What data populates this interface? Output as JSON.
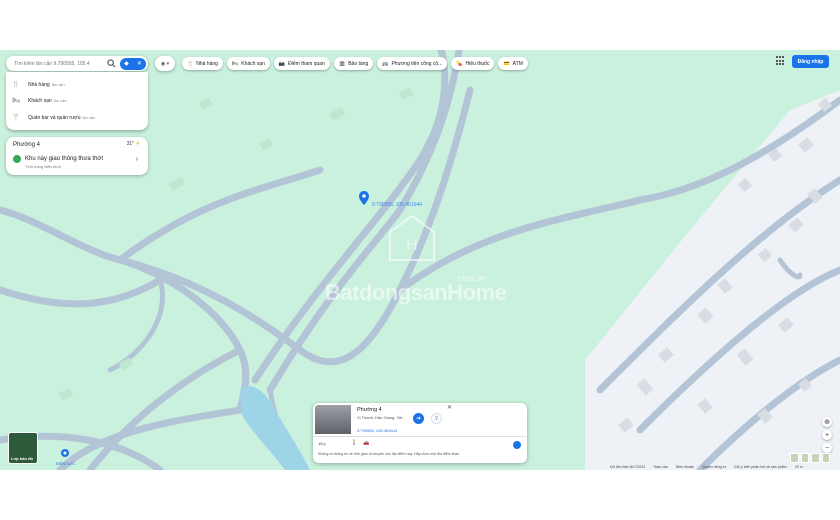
{
  "search": {
    "placeholder": "Tìm kiếm lân cận 9.790555, 105.4",
    "value": ""
  },
  "dropdown": [
    {
      "icon": "fork-knife-icon",
      "glyph": "🍴",
      "label": "Nhà hàng",
      "hint": "lân cận"
    },
    {
      "icon": "bed-icon",
      "glyph": "🛏",
      "label": "Khách sạn",
      "hint": "lân cận"
    },
    {
      "icon": "glass-icon",
      "glyph": "🍸",
      "label": "Quán bar và quán rượu",
      "hint": "lân cận"
    }
  ],
  "weather": {
    "place": "Phường 4",
    "temp": "31°",
    "status": "Khu này giao thông thưa thớt",
    "sub": "Tình trạng điển hình"
  },
  "chips": [
    {
      "icon": "fork-knife-icon",
      "glyph": "🍴",
      "label": "Nhà hàng"
    },
    {
      "icon": "bed-icon",
      "glyph": "🛏",
      "label": "Khách sạn"
    },
    {
      "icon": "camera-icon",
      "glyph": "📷",
      "label": "Điểm tham quan"
    },
    {
      "icon": "museum-icon",
      "glyph": "🏛",
      "label": "Bảo tàng"
    },
    {
      "icon": "bus-icon",
      "glyph": "🚌",
      "label": "Phương tiện công cộ..."
    },
    {
      "icon": "pill-icon",
      "glyph": "💊",
      "label": "Hiệu thuốc"
    },
    {
      "icon": "atm-icon",
      "glyph": "💳",
      "label": "ATM"
    }
  ],
  "header": {
    "signin": "Đăng nhập"
  },
  "map": {
    "pin_label": "9.790555, 105.461644",
    "watermark": "BatdongsanHome",
    "watermark_domain": ".com.vn",
    "poi_label": "ĐIỆN LỰC"
  },
  "info_card": {
    "title": "Phường 4",
    "address": "Vị Thanh, Hậu Giang, Việ...",
    "coords": "9.790555, 105.461644",
    "time": "15 p",
    "note": "Không có thông tin về thời gian di chuyển cho địa điểm này. Hãy chọn một địa điểm khác"
  },
  "layer_toggle": "Lớp bản đồ",
  "footer": {
    "items": [
      "Dữ liệu bản đồ ©2024",
      "Toàn cầu",
      "Điều khoản",
      "Quyền riêng tư",
      "Gửi ý kiến phản hồi về sản phẩm",
      "20 m"
    ]
  },
  "colors": {
    "map_bg": "#c9f1dd",
    "road": "#b3c4d6",
    "water": "#9ed4e8",
    "accent": "#1a73e8"
  }
}
